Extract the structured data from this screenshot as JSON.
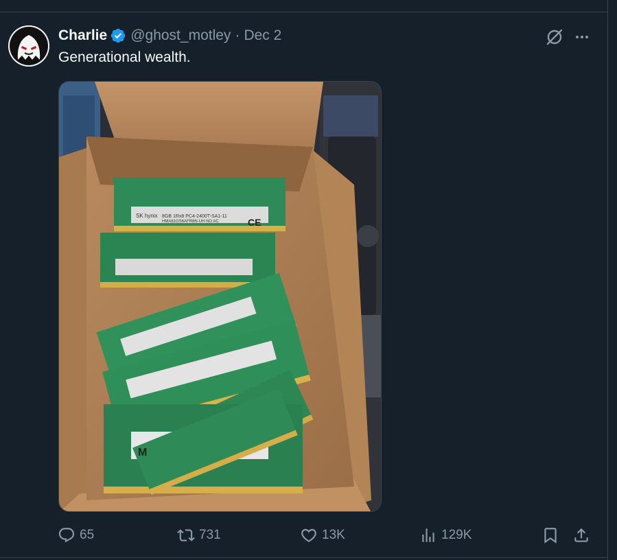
{
  "tweet": {
    "author_name": "Charlie",
    "handle": "@ghost_motley",
    "separator": "·",
    "date": "Dec 2",
    "text": "Generational wealth."
  },
  "media": {
    "module_label_1": "SK hynix",
    "module_label_2": "8GB 1Rx8 PC4-2400T-SA1-11",
    "module_label_3": "HMA81GS6AFR8N-UH NO AC",
    "ce_mark": "CE",
    "brand_bottom": "M"
  },
  "actions": {
    "replies": "65",
    "reposts": "731",
    "likes": "13K",
    "views": "129K"
  },
  "colors": {
    "background": "#15202b",
    "text_primary": "#f7f9f9",
    "text_secondary": "#8b98a5",
    "verified": "#1d9bf0",
    "border": "#38444d"
  },
  "icons": [
    "verified-badge-icon",
    "grok-icon",
    "more-icon",
    "reply-icon",
    "retweet-icon",
    "like-icon",
    "views-icon",
    "bookmark-icon",
    "share-icon"
  ]
}
